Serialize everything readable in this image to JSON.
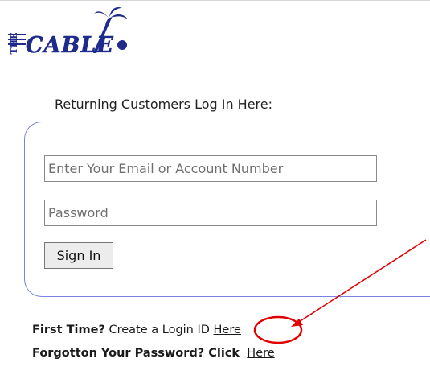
{
  "logo": {
    "text": "CABLE",
    "prefix": "THE",
    "color": "#1e2a8c"
  },
  "login": {
    "heading": "Returning Customers Log In Here:",
    "email_placeholder": "Enter Your Email or Account Number",
    "password_placeholder": "Password",
    "sign_in_label": "Sign In",
    "panel_border_color": "#7d82e2"
  },
  "help": {
    "first_time_bold": "First Time?",
    "first_time_text": "Create a Login ID",
    "first_time_link": "Here",
    "forgot_bold": "Forgotton Your Password? Click",
    "forgot_link": "Here"
  },
  "annotation": {
    "color": "#e00000",
    "icon": "red-arrow-pointing-to-link"
  }
}
